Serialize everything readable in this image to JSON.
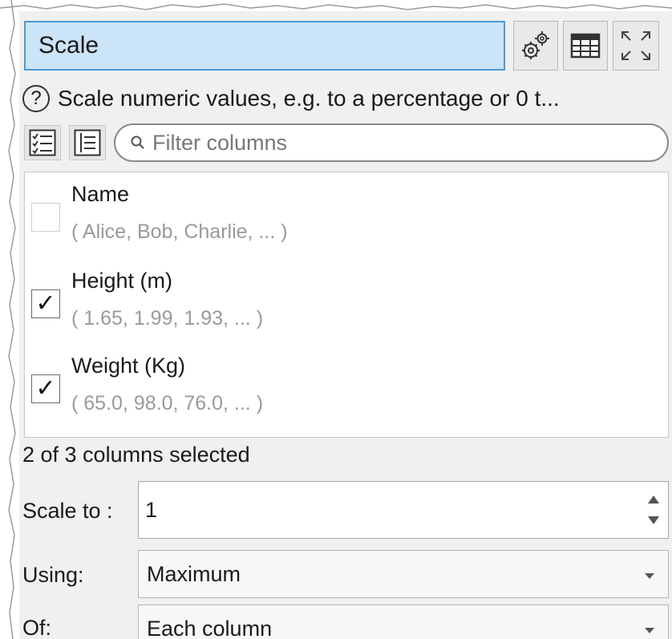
{
  "panel": {
    "title": "Scale",
    "toolbar_icons": [
      "settings-gears-icon",
      "table-icon",
      "maximize-icon"
    ]
  },
  "help": {
    "icon": "?",
    "text": "Scale numeric values, e.g. to a percentage or 0 t..."
  },
  "filter": {
    "placeholder": "Filter columns",
    "buttons": [
      "checklist-icon",
      "list-icon"
    ]
  },
  "columns": [
    {
      "name": "Name",
      "sample": "( Alice, Bob, Charlie, ... )",
      "checked": false,
      "mark": ""
    },
    {
      "name": "Height (m)",
      "sample": "( 1.65, 1.99, 1.93, ... )",
      "checked": true,
      "mark": "✓"
    },
    {
      "name": "Weight (Kg)",
      "sample": "( 65.0, 98.0, 76.0, ... )",
      "checked": true,
      "mark": "✓"
    }
  ],
  "selection_status": "2 of 3 columns selected",
  "scale_to": {
    "label": "Scale to :",
    "value": "1"
  },
  "using": {
    "label": "Using:",
    "value": "Maximum"
  },
  "of": {
    "label": "Of:",
    "value": "Each column"
  },
  "colors": {
    "title_bg": "#cce4f7",
    "title_border": "#4c9ad6",
    "panel_bg": "#f0f0f0",
    "sample_text": "#9a9a9a"
  }
}
